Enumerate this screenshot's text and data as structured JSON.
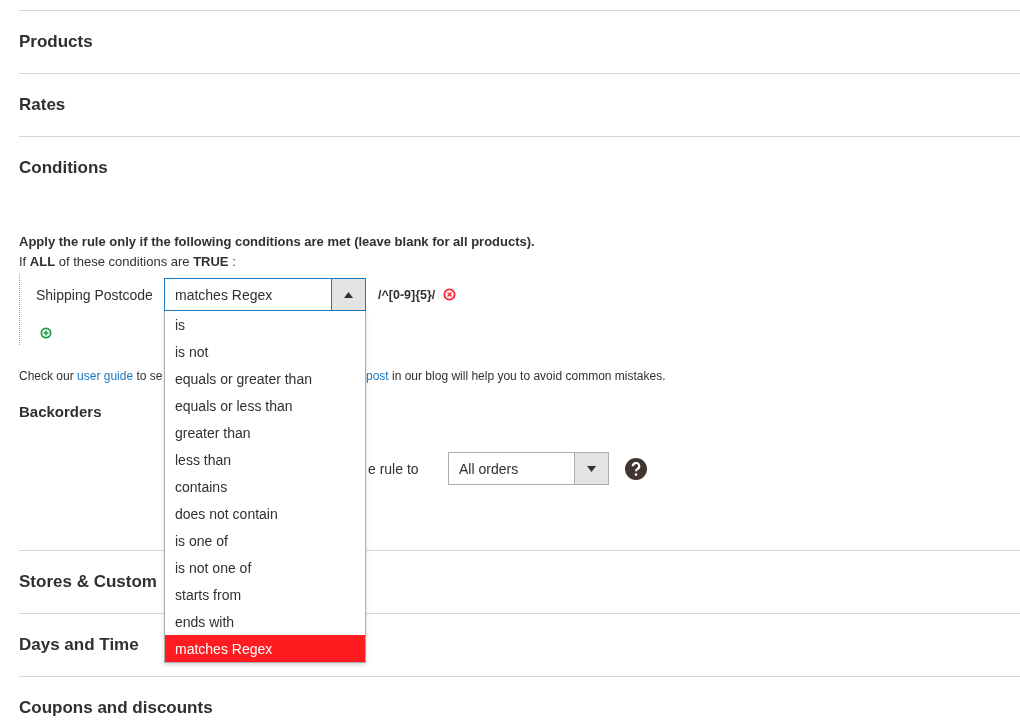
{
  "sections_top": [
    {
      "title": "Products"
    },
    {
      "title": "Rates"
    }
  ],
  "conditions": {
    "title": "Conditions",
    "intro": "Apply the rule only if the following conditions are met (leave blank for all products).",
    "if_line": "If **ALL**  of these conditions are **TRUE** :",
    "rule": {
      "attribute": "Shipping Postcode",
      "operator": "matches Regex",
      "expanded": true,
      "value": "/^[0-9]{5}/",
      "options": [
        {
          "label": "is",
          "selected": false
        },
        {
          "label": "is not",
          "selected": false
        },
        {
          "label": "equals or greater than",
          "selected": false
        },
        {
          "label": "equals or less than",
          "selected": false
        },
        {
          "label": "greater than",
          "selected": false
        },
        {
          "label": "less than",
          "selected": false
        },
        {
          "label": "contains",
          "selected": false
        },
        {
          "label": "does not contain",
          "selected": false
        },
        {
          "label": "is one of",
          "selected": false
        },
        {
          "label": "is not one of",
          "selected": false
        },
        {
          "label": "starts from",
          "selected": false
        },
        {
          "label": "ends with",
          "selected": false
        },
        {
          "label": "matches Regex",
          "selected": true
        }
      ]
    },
    "help_left": {
      "before": "Check our ",
      "link": "user guide",
      "after": " to se"
    },
    "help_right": {
      "link": "post",
      "after": " in our blog will help you to avoid common mistakes."
    },
    "backorders": {
      "title": "Backorders",
      "label": "e rule to",
      "value": "All orders"
    }
  },
  "sections_bottom": [
    {
      "title": "Stores & Custom"
    },
    {
      "title": "Days and Time"
    },
    {
      "title": "Coupons and discounts"
    }
  ]
}
